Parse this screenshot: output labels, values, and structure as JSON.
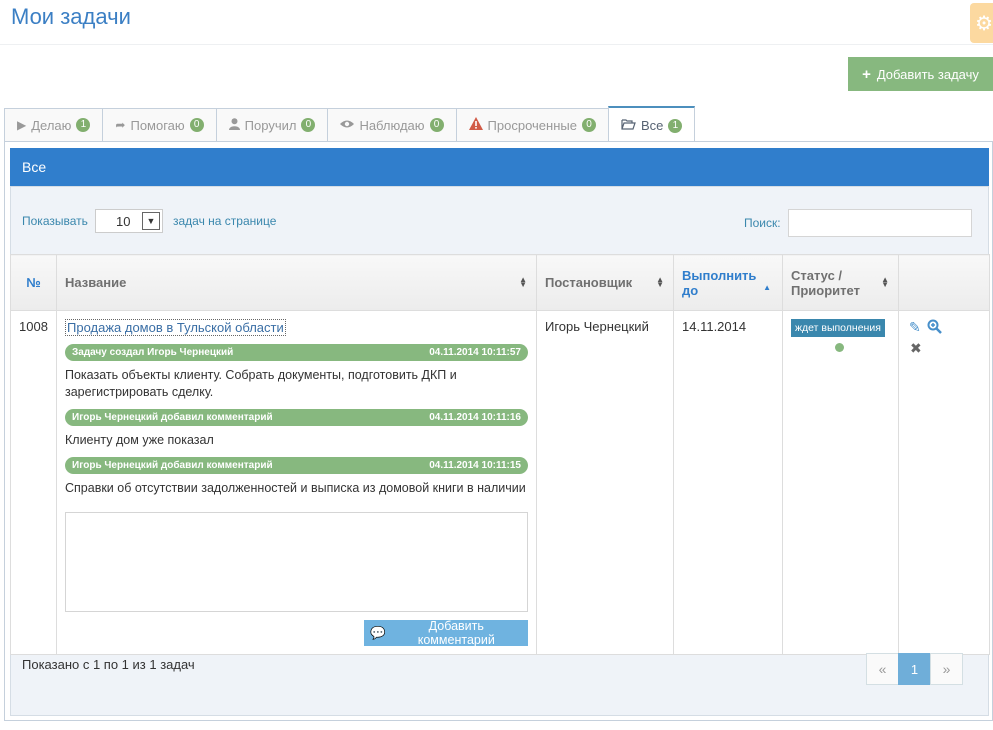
{
  "page": {
    "title": "Мои задачи"
  },
  "toolbar": {
    "add_task_label": "Добавить задачу"
  },
  "tabs": [
    {
      "label": "Делаю",
      "icon": "play-icon",
      "count": "1"
    },
    {
      "label": "Помогаю",
      "icon": "share-icon",
      "count": "0"
    },
    {
      "label": "Поручил",
      "icon": "user-icon",
      "count": "0"
    },
    {
      "label": "Наблюдаю",
      "icon": "eye-icon",
      "count": "0"
    },
    {
      "label": "Просроченные",
      "icon": "warning-icon",
      "count": "0"
    },
    {
      "label": "Все",
      "icon": "folder-open-icon",
      "count": "1",
      "active": true
    }
  ],
  "panel": {
    "heading": "Все"
  },
  "filters": {
    "show_label": "Показывать",
    "per_page_value": "10",
    "per_page_suffix": "задач на странице",
    "search_label": "Поиск:",
    "search_value": ""
  },
  "table": {
    "columns": {
      "num": "№",
      "name": "Название",
      "author": "Постановщик",
      "due_line1": "Выполнить",
      "due_line2": "до",
      "status_line1": "Статус /",
      "status_line2": "Приоритет"
    },
    "rows": [
      {
        "num": "1008",
        "title": "Продажа домов в Тульской области",
        "events": [
          {
            "header": "Задачу создал Игорь Чернецкий",
            "time": "04.11.2014 10:11:57",
            "text": "Показать объекты клиенту. Собрать документы, подготовить ДКП и зарегистрировать сделку."
          },
          {
            "header": "Игорь Чернецкий добавил комментарий",
            "time": "04.11.2014 10:11:16",
            "text": "Клиенту дом уже показал"
          },
          {
            "header": "Игорь Чернецкий добавил комментарий",
            "time": "04.11.2014 10:11:15",
            "text": "Справки об отсутствии задолженностей и выписка из домовой книги в наличии"
          }
        ],
        "comment_placeholder": "",
        "add_comment_label": "Добавить комментарий",
        "author": "Игорь Чернецкий",
        "due": "14.11.2014",
        "status": "ждет выполнения",
        "priority_color": "#87b87f"
      }
    ]
  },
  "footer": {
    "info": "Показано с 1 по 1 из 1 задач",
    "pager": {
      "prev": "«",
      "current": "1",
      "next": "»"
    }
  },
  "colors": {
    "accent": "#307ecc",
    "success": "#87b87f",
    "title": "#3b7fc4"
  }
}
